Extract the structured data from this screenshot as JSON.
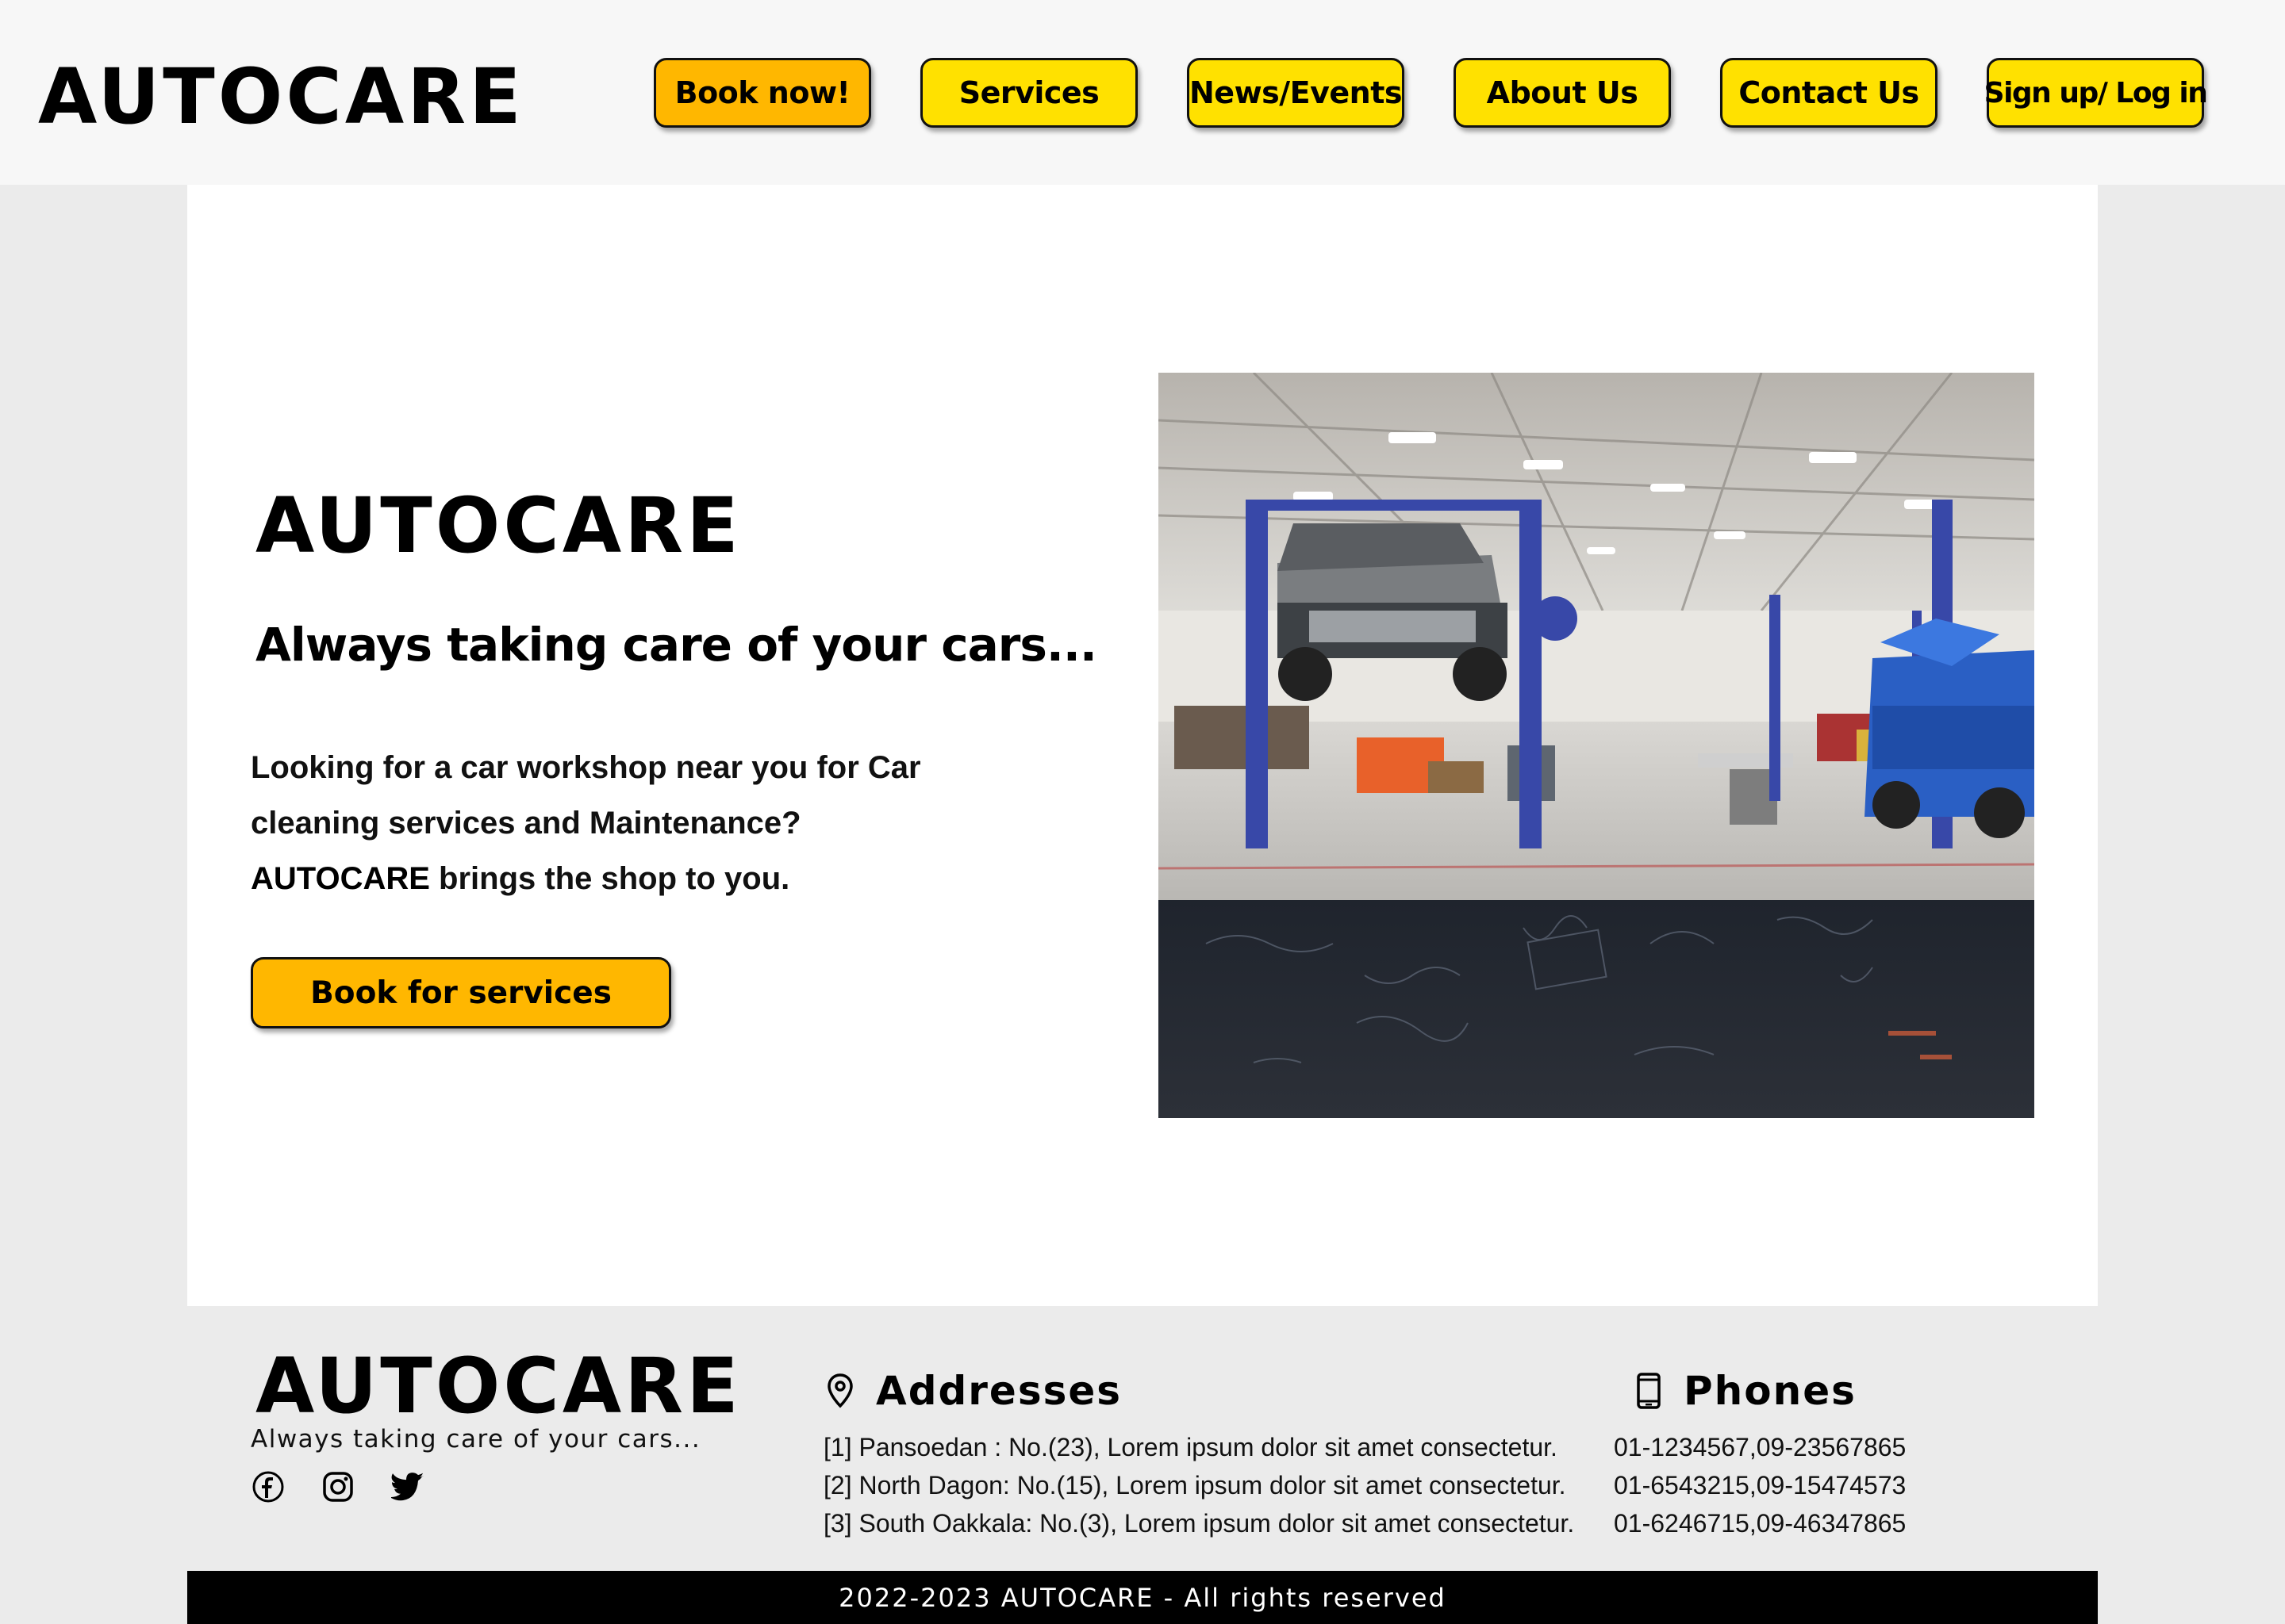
{
  "header": {
    "brand": "AUTOCARE",
    "nav": [
      {
        "label": "Book now!"
      },
      {
        "label": "Services"
      },
      {
        "label": "News/Events"
      },
      {
        "label": "About Us"
      },
      {
        "label": "Contact Us"
      },
      {
        "label": "Sign up/ Log in"
      }
    ]
  },
  "hero": {
    "title": "AUTOCARE",
    "tagline": "Always taking care of your cars...",
    "desc_line1": "Looking for a car workshop near you for Car",
    "desc_line2": "cleaning services and Maintenance?",
    "desc_brand": "AUTOCARE",
    "desc_line3_rest": " brings the shop to you.",
    "cta": "Book for services",
    "image_alt": "car-workshop-photo"
  },
  "footer": {
    "brand": "AUTOCARE",
    "tagline": "Always taking care of your cars...",
    "socials": [
      "facebook-icon",
      "instagram-icon",
      "twitter-icon"
    ],
    "addresses_title": "Addresses",
    "addresses": [
      "[1] Pansoedan : No.(23), Lorem ipsum dolor sit amet consectetur.",
      "[2] North Dagon: No.(15), Lorem ipsum dolor sit amet consectetur.",
      "[3] South Oakkala: No.(3), Lorem ipsum dolor sit amet consectetur."
    ],
    "phones_title": "Phones",
    "phones": [
      "01-1234567,09-23567865",
      "01-6543215,09-15474573",
      "01-6246715,09-46347865"
    ],
    "copyright": "2022-2023 AUTOCARE - All rights reserved"
  },
  "colors": {
    "accent_yellow": "#ffe100",
    "accent_orange": "#ffb700",
    "header_bg": "#f7f7f7",
    "page_bg": "#ebebeb"
  }
}
